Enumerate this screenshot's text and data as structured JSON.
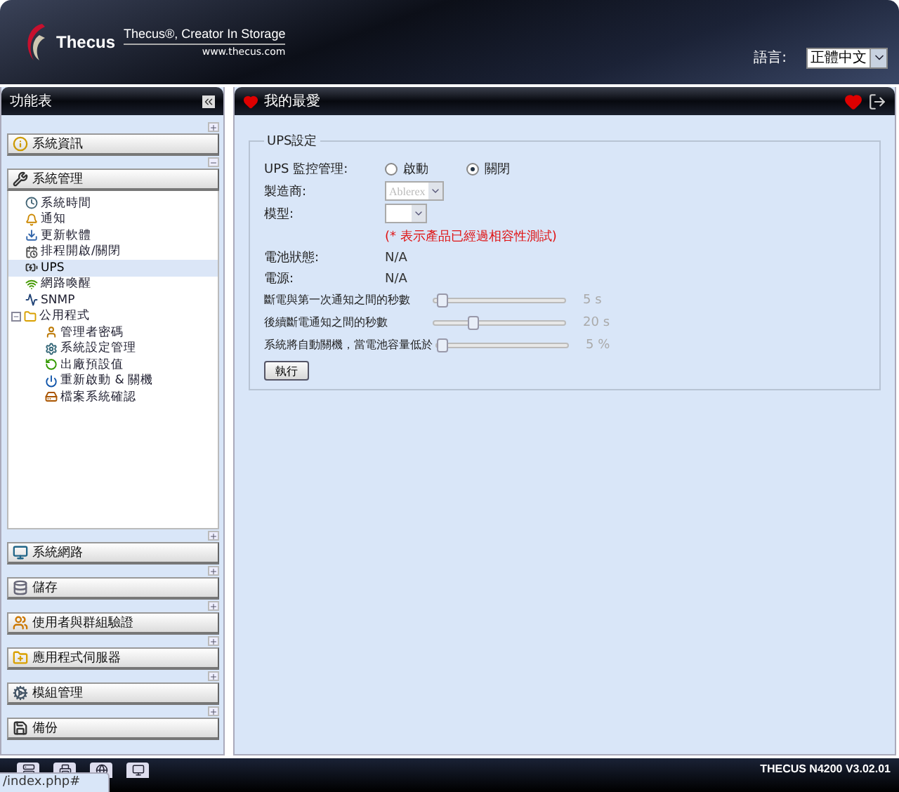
{
  "header": {
    "logo": "Thecus",
    "tagline": "Thecus®, Creator In Storage",
    "website": "www.thecus.com",
    "language_label": "語言:",
    "language_value": "正體中文"
  },
  "sidebar": {
    "title": "功能表",
    "sections": [
      {
        "label": "系統資訊",
        "expanded": false
      },
      {
        "label": "系統管理",
        "expanded": true,
        "items": [
          {
            "label": "系統時間",
            "selected": false
          },
          {
            "label": "通知",
            "selected": false
          },
          {
            "label": "更新軟體",
            "selected": false
          },
          {
            "label": "排程開啟/關閉",
            "selected": false
          },
          {
            "label": "UPS",
            "selected": true
          },
          {
            "label": "網路喚醒",
            "selected": false
          },
          {
            "label": "SNMP",
            "selected": false
          },
          {
            "label": "公用程式",
            "selected": false,
            "expanded": true,
            "children": [
              {
                "label": "管理者密碼",
                "selected": false
              },
              {
                "label": "系統設定管理",
                "selected": false
              },
              {
                "label": "出廠預設值",
                "selected": false
              },
              {
                "label": "重新啟動 & 關機",
                "selected": false
              },
              {
                "label": "檔案系統確認",
                "selected": false
              }
            ]
          }
        ]
      },
      {
        "label": "系統網路",
        "expanded": false
      },
      {
        "label": "儲存",
        "expanded": false
      },
      {
        "label": "使用者與群組驗證",
        "expanded": false
      },
      {
        "label": "應用程式伺服器",
        "expanded": false
      },
      {
        "label": "模組管理",
        "expanded": false
      },
      {
        "label": "備份",
        "expanded": false
      }
    ]
  },
  "main": {
    "title": "我的最愛",
    "fieldset": "UPS設定",
    "monitor": {
      "label": "UPS 監控管理:",
      "options": [
        {
          "label": "啟動",
          "selected": false
        },
        {
          "label": "關閉",
          "selected": true
        }
      ]
    },
    "manufacturer": {
      "label": "製造商:",
      "value": "Ablerex",
      "disabled": true
    },
    "model": {
      "label": "模型:"
    },
    "note": "(* 表示產品已經過相容性測試)",
    "status": [
      {
        "label": "電池狀態:",
        "value": "N/A"
      },
      {
        "label": "電源:",
        "value": "N/A"
      }
    ],
    "sliders": [
      {
        "label": "斷電與第一次通知之間的秒數",
        "level": 0.02,
        "reading": "5 s"
      },
      {
        "label": "後續斷電通知之間的秒數",
        "level": 0.28,
        "reading": "20 s"
      },
      {
        "label": "系統將自動關機，當電池容量低於",
        "level": 0.0,
        "reading": "5 %"
      }
    ],
    "button": "執行"
  },
  "footer": {
    "version": "THECUS N4200 V3.02.01",
    "status_url": "/index.php#"
  }
}
